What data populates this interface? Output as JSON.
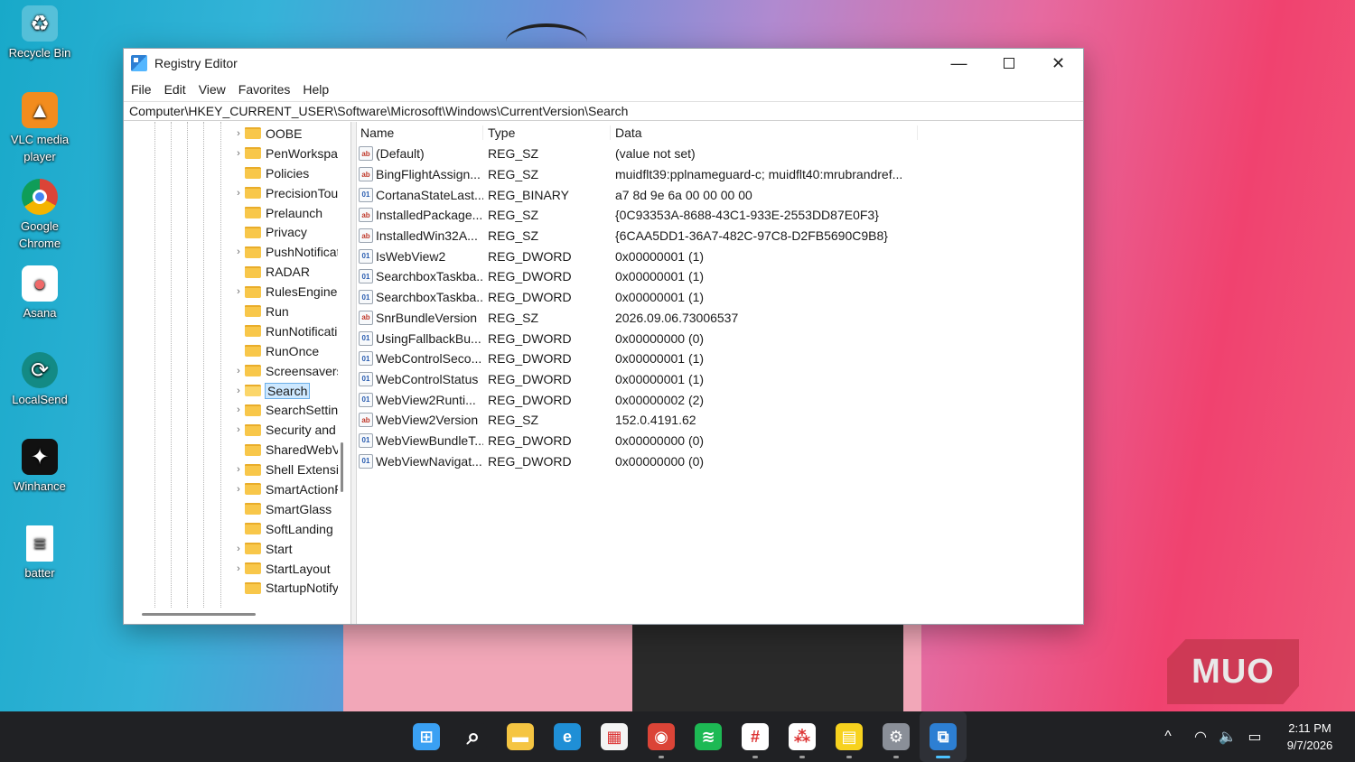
{
  "desktop": {
    "icons": [
      {
        "label": "Recycle Bin",
        "icon": "recycle-bin-icon"
      },
      {
        "label": "VLC media player",
        "icon": "vlc-icon"
      },
      {
        "label": "Google Chrome",
        "icon": "chrome-icon"
      },
      {
        "label": "Asana",
        "icon": "asana-icon"
      },
      {
        "label": "LocalSend",
        "icon": "localsend-icon"
      },
      {
        "label": "Winhance",
        "icon": "winhance-icon"
      },
      {
        "label": "batter",
        "icon": "text-file-icon"
      }
    ]
  },
  "window": {
    "title": "Registry Editor",
    "menu": [
      "File",
      "Edit",
      "View",
      "Favorites",
      "Help"
    ],
    "address": "Computer\\HKEY_CURRENT_USER\\Software\\Microsoft\\Windows\\CurrentVersion\\Search",
    "tree": [
      {
        "label": "OOBE",
        "expandable": true
      },
      {
        "label": "PenWorkspace",
        "expandable": true
      },
      {
        "label": "Policies",
        "expandable": false
      },
      {
        "label": "PrecisionTouchPad",
        "expandable": true
      },
      {
        "label": "Prelaunch",
        "expandable": false
      },
      {
        "label": "Privacy",
        "expandable": false
      },
      {
        "label": "PushNotifications",
        "expandable": true
      },
      {
        "label": "RADAR",
        "expandable": false
      },
      {
        "label": "RulesEngine",
        "expandable": true
      },
      {
        "label": "Run",
        "expandable": false
      },
      {
        "label": "RunNotification",
        "expandable": false
      },
      {
        "label": "RunOnce",
        "expandable": false
      },
      {
        "label": "Screensavers",
        "expandable": true
      },
      {
        "label": "Search",
        "expandable": true,
        "selected": true
      },
      {
        "label": "SearchSettings",
        "expandable": true
      },
      {
        "label": "Security and Maintenance",
        "expandable": true
      },
      {
        "label": "SharedWebView",
        "expandable": false
      },
      {
        "label": "Shell Extensions",
        "expandable": true
      },
      {
        "label": "SmartActionPlatform",
        "expandable": true
      },
      {
        "label": "SmartGlass",
        "expandable": false
      },
      {
        "label": "SoftLanding",
        "expandable": false
      },
      {
        "label": "Start",
        "expandable": true
      },
      {
        "label": "StartLayout",
        "expandable": true
      },
      {
        "label": "StartupNotify",
        "expandable": false
      }
    ],
    "columns": {
      "name": "Name",
      "type": "Type",
      "data": "Data"
    },
    "values": [
      {
        "name": "(Default)",
        "type": "REG_SZ",
        "data": "(value not set)",
        "kind": "sz"
      },
      {
        "name": "BingFlightAssign...",
        "type": "REG_SZ",
        "data": "muidflt39:pplnameguard-c; muidflt40:mrubrandref...",
        "kind": "sz"
      },
      {
        "name": "CortanaStateLast...",
        "type": "REG_BINARY",
        "data": "a7 8d 9e 6a 00 00 00 00",
        "kind": "bin"
      },
      {
        "name": "InstalledPackage...",
        "type": "REG_SZ",
        "data": "{0C93353A-8688-43C1-933E-2553DD87E0F3}",
        "kind": "sz"
      },
      {
        "name": "InstalledWin32A...",
        "type": "REG_SZ",
        "data": "{6CAA5DD1-36A7-482C-97C8-D2FB5690C9B8}",
        "kind": "sz"
      },
      {
        "name": "IsWebView2",
        "type": "REG_DWORD",
        "data": "0x00000001 (1)",
        "kind": "bin"
      },
      {
        "name": "SearchboxTaskba...",
        "type": "REG_DWORD",
        "data": "0x00000001 (1)",
        "kind": "bin"
      },
      {
        "name": "SearchboxTaskba...",
        "type": "REG_DWORD",
        "data": "0x00000001 (1)",
        "kind": "bin"
      },
      {
        "name": "SnrBundleVersion",
        "type": "REG_SZ",
        "data": "2026.09.06.73006537",
        "kind": "sz"
      },
      {
        "name": "UsingFallbackBu...",
        "type": "REG_DWORD",
        "data": "0x00000000 (0)",
        "kind": "bin"
      },
      {
        "name": "WebControlSeco...",
        "type": "REG_DWORD",
        "data": "0x00000001 (1)",
        "kind": "bin"
      },
      {
        "name": "WebControlStatus",
        "type": "REG_DWORD",
        "data": "0x00000001 (1)",
        "kind": "bin"
      },
      {
        "name": "WebView2Runti...",
        "type": "REG_DWORD",
        "data": "0x00000002 (2)",
        "kind": "bin"
      },
      {
        "name": "WebView2Version",
        "type": "REG_SZ",
        "data": "152.0.4191.62",
        "kind": "sz"
      },
      {
        "name": "WebViewBundleT...",
        "type": "REG_DWORD",
        "data": "0x00000000 (0)",
        "kind": "bin"
      },
      {
        "name": "WebViewNavigat...",
        "type": "REG_DWORD",
        "data": "0x00000000 (0)",
        "kind": "bin"
      }
    ]
  },
  "watermark": "MUO",
  "taskbar": {
    "apps": [
      {
        "icon": "windows-start-icon",
        "color": "#3aa0f3",
        "running": false,
        "active": false
      },
      {
        "icon": "search-icon",
        "color": "#202124",
        "running": false,
        "active": false
      },
      {
        "icon": "file-explorer-icon",
        "color": "#f5c542",
        "running": false,
        "active": false
      },
      {
        "icon": "edge-icon",
        "color": "#1f8fd6",
        "running": false,
        "active": false
      },
      {
        "icon": "microsoft-store-icon",
        "color": "#f4f4f4",
        "running": false,
        "active": false
      },
      {
        "icon": "chrome-icon",
        "color": "#db4437",
        "running": true,
        "active": false
      },
      {
        "icon": "spotify-icon",
        "color": "#1db954",
        "running": false,
        "active": false
      },
      {
        "icon": "slack-icon",
        "color": "#ffffff",
        "running": true,
        "active": false
      },
      {
        "icon": "asana-icon",
        "color": "#ffffff",
        "running": true,
        "active": false
      },
      {
        "icon": "sticky-notes-icon",
        "color": "#f7d21e",
        "running": true,
        "active": false
      },
      {
        "icon": "settings-icon",
        "color": "#8a8f98",
        "running": true,
        "active": false
      },
      {
        "icon": "registry-editor-icon",
        "color": "#2d7fd3",
        "running": true,
        "active": true
      }
    ],
    "clock": {
      "time": "2:11 PM",
      "date": "9/7/2026"
    }
  }
}
